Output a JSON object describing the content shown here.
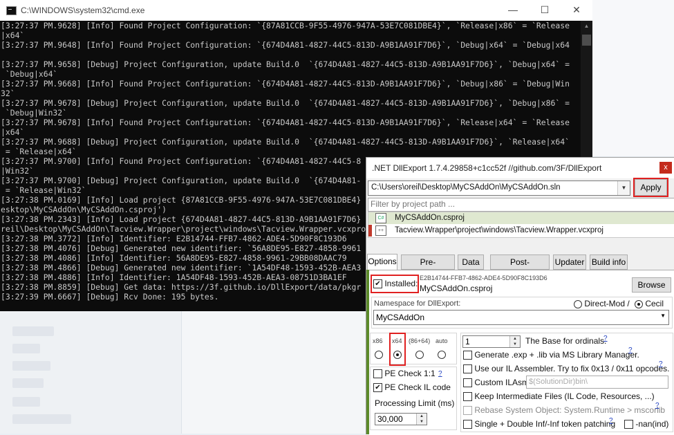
{
  "cmd": {
    "title": "C:\\WINDOWS\\system32\\cmd.exe",
    "lines": [
      "[3:27:37 PM.9628] [Info] Found Project Configuration: `{87A81CCB-9F55-4976-947A-53E7C081DBE4}`, `Release|x86` = `Release",
      "|x64`",
      "[3:27:37 PM.9648] [Info] Found Project Configuration: `{674D4A81-4827-44C5-813D-A9B1AA91F7D6}`, `Debug|x64` = `Debug|x64",
      "",
      "[3:27:37 PM.9658] [Debug] Project Configuration, update Build.0  `{674D4A81-4827-44C5-813D-A9B1AA91F7D6}`, `Debug|x64` =",
      " `Debug|x64`",
      "[3:27:37 PM.9668] [Info] Found Project Configuration: `{674D4A81-4827-44C5-813D-A9B1AA91F7D6}`, `Debug|x86` = `Debug|Win",
      "32`",
      "[3:27:37 PM.9678] [Debug] Project Configuration, update Build.0  `{674D4A81-4827-44C5-813D-A9B1AA91F7D6}`, `Debug|x86` =",
      " `Debug|Win32`",
      "[3:27:37 PM.9678] [Info] Found Project Configuration: `{674D4A81-4827-44C5-813D-A9B1AA91F7D6}`, `Release|x64` = `Release",
      "|x64`",
      "[3:27:37 PM.9688] [Debug] Project Configuration, update Build.0  `{674D4A81-4827-44C5-813D-A9B1AA91F7D6}`, `Release|x64`",
      " = `Release|x64`",
      "[3:27:37 PM.9700] [Info] Found Project Configuration: `{674D4A81-4827-44C5-8",
      "|Win32`",
      "[3:27:37 PM.9700] [Debug] Project Configuration, update Build.0  `{674D4A81-",
      " = `Release|Win32`",
      "[3:27:38 PM.0169] [Info] Load project {87A81CCB-9F55-4976-947A-53E7C081DBE4}",
      "esktop\\MyCSAddOn\\MyCSAddOn.csproj')",
      "[3:27:38 PM.2343] [Info] Load project {674D4A81-4827-44C5-813D-A9B1AA91F7D6}",
      "reil\\Desktop\\MyCSAddOn\\Tacview.Wrapper\\project\\windows\\Tacview.Wrapper.vcxpro",
      "[3:27:38 PM.3772] [Info] Identifier: E2B14744-FFB7-4862-ADE4-5D90F8C193D6",
      "[3:27:38 PM.4076] [Debug] Generated new identifier: `56A8DE95-E827-4858-9961",
      "[3:27:38 PM.4086] [Info] Identifier: 56A8DE95-E827-4858-9961-29BB08DAAC79",
      "[3:27:38 PM.4866] [Debug] Generated new identifier: `1A54DF48-1593-452B-AEA3",
      "[3:27:38 PM.4886] [Info] Identifier: 1A54DF48-1593-452B-AEA3-08751D3BA1EF",
      "[3:27:38 PM.8859] [Debug] Get data: https://3f.github.io/DllExport/data/pkgr",
      "[3:27:39 PM.6667] [Debug] Rcv Done: 195 bytes."
    ]
  },
  "dll": {
    "title": ".NET DllExport 1.7.4.29858+c1cc52f //github.com/3F/DllExport",
    "close_glyph": "x",
    "solution_path": "C:\\Users\\oreil\\Desktop\\MyCSAddOn\\MyCSAddOn.sln",
    "apply_label": "Apply",
    "filter_placeholder": "Filter by project path ...",
    "projects": [
      {
        "name": "MyCSAddOn.csproj",
        "icon": "C#"
      },
      {
        "name": "Tacview.Wrapper\\project\\windows\\Tacview.Wrapper.vcxproj",
        "icon": "++"
      }
    ],
    "tabs": [
      "Options",
      "Pre-processing",
      "Data",
      "Post-processing",
      "Updater",
      "Build info"
    ],
    "installed_label": "Installed:",
    "installed_checked": true,
    "identifier": "E2B14744-FFB7-4862-ADE4-5D90F8C193D6",
    "project_file": "MyCSAddOn.csproj",
    "browse_label": "Browse",
    "namespace_label": "Namespace for DllExport:",
    "direct_mod_label": "Direct-Mod /",
    "cecil_label": "Cecil",
    "namespace_value": "MyCSAddOn",
    "arch": [
      "x86",
      "x64",
      "(86+64)",
      "auto"
    ],
    "arch_selected": "x64",
    "pe_check_11_label": "PE Check 1:1",
    "pe_check_il_label": "PE Check IL code",
    "processing_limit_label": "Processing Limit (ms)",
    "processing_limit_value": "30,000",
    "ordinal_value": "1",
    "ordinal_label": "The Base for ordinals.",
    "gen_exp_label": "Generate .exp + .lib via MS Library Manager.",
    "use_il_label": "Use our IL Assembler. Try to fix 0x13 / 0x11 opcodes.",
    "custom_ilasm_label": "Custom ILAsm:",
    "custom_ilasm_placeholder": "$(SolutionDir)bin\\",
    "keep_intermediate_label": "Keep Intermediate Files (IL Code, Resources, ...)",
    "rebase_label": "Rebase System Object: System.Runtime > mscorlib",
    "single_double_label": "Single + Double Inf/-Inf token patching",
    "nan_label": "-nan(ind)",
    "help_glyph": "?"
  }
}
